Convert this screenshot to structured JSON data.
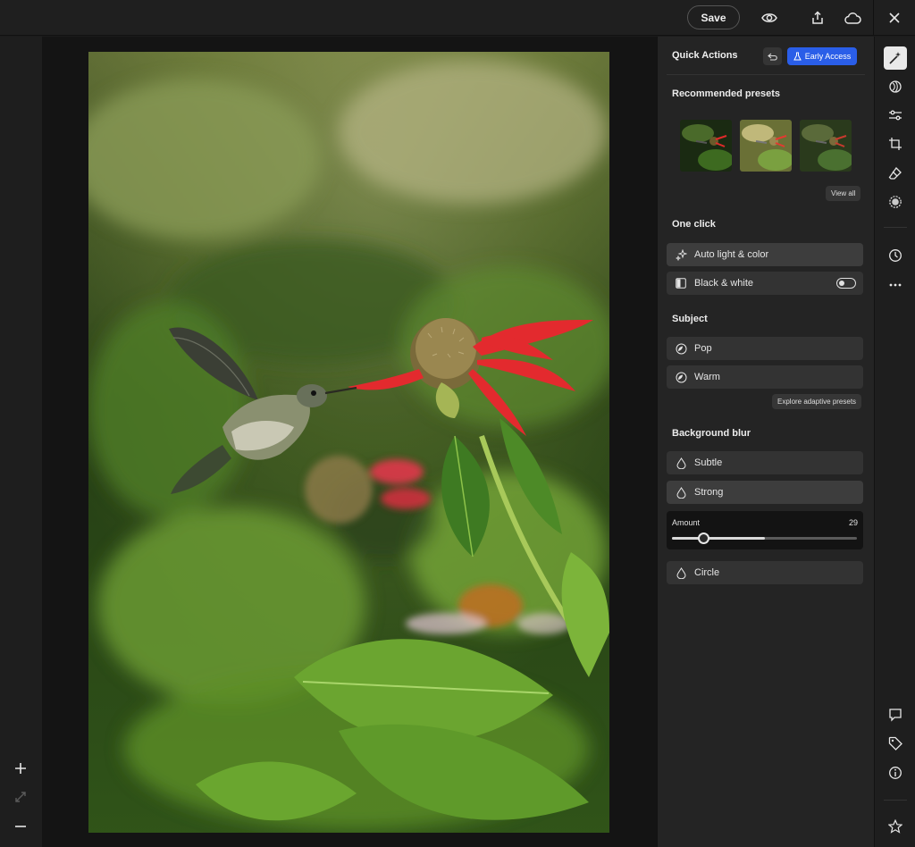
{
  "topbar": {
    "save_label": "Save",
    "icons": [
      "eye-icon",
      "share-icon",
      "cloud-icon",
      "close-icon"
    ]
  },
  "left_rail": {
    "icons": [
      "zoom-in-icon",
      "fit-screen-icon",
      "zoom-out-icon"
    ]
  },
  "panel": {
    "title": "Quick Actions",
    "early_access_label": "Early Access",
    "recommended": {
      "heading": "Recommended presets",
      "view_all_label": "View all"
    },
    "one_click": {
      "heading": "One click",
      "items": [
        {
          "label": "Auto light & color",
          "icon": "sparkle-icon"
        },
        {
          "label": "Black & white",
          "icon": "bw-square-icon",
          "toggle": false
        }
      ]
    },
    "subject": {
      "heading": "Subject",
      "items": [
        {
          "label": "Pop",
          "icon": "subject-icon"
        },
        {
          "label": "Warm",
          "icon": "subject-icon"
        }
      ],
      "explore_label": "Explore adaptive presets"
    },
    "background_blur": {
      "heading": "Background blur",
      "items": [
        {
          "label": "Subtle",
          "icon": "drop-icon"
        },
        {
          "label": "Strong",
          "icon": "drop-icon",
          "active": true
        },
        {
          "label": "Circle",
          "icon": "drop-icon"
        }
      ],
      "amount_label": "Amount",
      "amount_value": "29",
      "amount_level": 0.5
    }
  },
  "tools": [
    "magic-wand-icon",
    "presets-icon",
    "sliders-icon",
    "crop-icon",
    "eraser-icon",
    "mask-icon",
    "history-icon",
    "more-icon",
    "comment-icon",
    "tag-icon",
    "info-icon",
    "star-icon"
  ],
  "colors": {
    "accent": "#2a5ee8",
    "panel": "#242424",
    "button": "#333333"
  }
}
